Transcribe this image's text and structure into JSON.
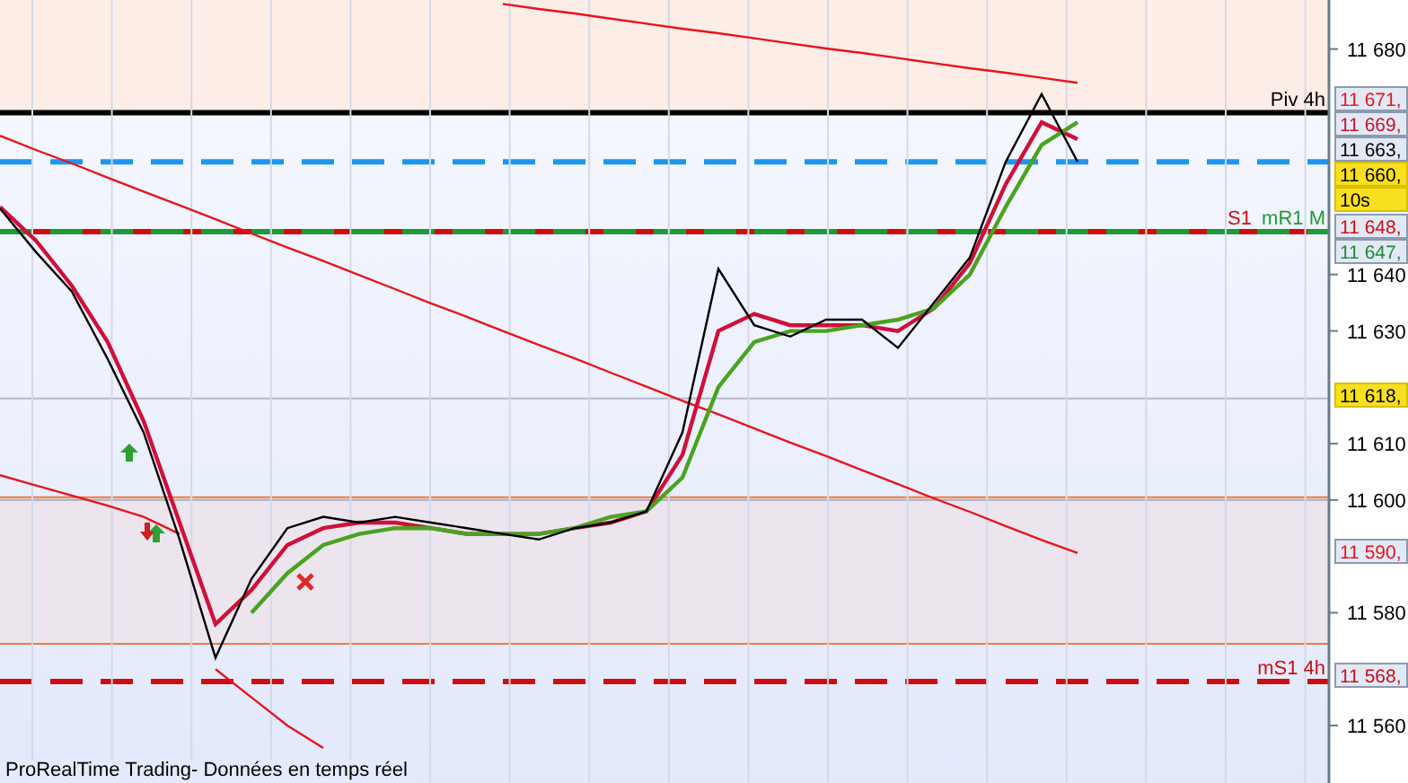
{
  "chart": {
    "chart_data": {
      "type": "line",
      "categories": [
        null,
        null,
        null,
        null,
        null,
        null,
        null,
        null,
        null,
        null,
        null,
        null,
        null,
        null,
        null,
        null,
        null,
        null,
        null,
        null,
        null,
        null,
        null,
        null,
        null,
        null,
        null,
        null,
        null,
        null,
        null
      ],
      "ylim": [
        11549.8,
        11688.7
      ],
      "grid": true,
      "bands": [
        {
          "axis": "y",
          "from": 11668.7,
          "to": 11688.7,
          "color": "#fcede7"
        },
        {
          "axis": "y",
          "from": 11574.5,
          "to": 11600.5,
          "color": "#ece5ee"
        }
      ],
      "ref_lines": [
        {
          "axis": "y",
          "value": 11618,
          "color": "#b4b8c8"
        },
        {
          "axis": "y",
          "value": 11600,
          "color": "#a8acb8"
        },
        {
          "axis": "y",
          "value": 11600.5,
          "color": "#f07a3a"
        },
        {
          "axis": "y",
          "value": 11574.5,
          "color": "#f07a3a"
        },
        {
          "axis": "y",
          "value": 11668.7,
          "color": "#000000",
          "label": "Piv 4h"
        },
        {
          "axis": "y",
          "value": 11660,
          "color": "#1e96f0"
        },
        {
          "axis": "y",
          "value": 11647.6,
          "color": "#d00c10",
          "label": "S1"
        },
        {
          "axis": "y",
          "value": 11647.6,
          "color": "#1e9a3a",
          "label": "mR1 M"
        },
        {
          "axis": "y",
          "value": 11567.8,
          "color": "#d00c10",
          "label": "mS1 4h"
        }
      ],
      "yticks": [
        {
          "value": 11560,
          "label": "11 560"
        },
        {
          "value": 11580,
          "label": "11 580"
        },
        {
          "value": 11600,
          "label": "11 600"
        },
        {
          "value": 11610,
          "label": "11 610"
        },
        {
          "value": 11630,
          "label": "11 630"
        },
        {
          "value": 11640,
          "label": "11 640"
        },
        {
          "value": 11680,
          "label": "11 680"
        }
      ],
      "series": [
        {
          "color": "#e8141c",
          "values": [
            null,
            null,
            null,
            null,
            null,
            null,
            null,
            null,
            null,
            null,
            null,
            null,
            null,
            null,
            11688.0,
            11687.1,
            11686.3,
            11685.4,
            11684.5,
            11683.6,
            11682.8,
            11681.9,
            11681.0,
            11680.1,
            11679.3,
            11678.4,
            11677.5,
            11676.6,
            11675.8,
            11674.9,
            11674.0
          ]
        },
        {
          "color": "#e8141c",
          "values": [
            11664.6,
            11662.1,
            11659.7,
            11657.2,
            11654.7,
            11652.3,
            11649.8,
            11647.3,
            11644.8,
            11642.4,
            11639.9,
            11637.4,
            11634.9,
            11632.5,
            11630.0,
            11627.5,
            11625.1,
            11622.6,
            11620.1,
            11617.6,
            11615.2,
            11612.7,
            11610.2,
            11607.8,
            11605.3,
            11602.8,
            11600.3,
            11597.9,
            11595.4,
            11592.9,
            11590.6
          ]
        },
        {
          "color": "#e8141c",
          "values": [
            11604.4,
            11602.6,
            11600.8,
            11599.0,
            11597.0,
            11594.0,
            null,
            null,
            null,
            null,
            null,
            null,
            null,
            null,
            null,
            null,
            null,
            null,
            null,
            null,
            null,
            null,
            null,
            null,
            null,
            null,
            null,
            null,
            null,
            null,
            null
          ]
        },
        {
          "color": "#e8141c",
          "values": [
            null,
            null,
            null,
            null,
            null,
            null,
            11570,
            11565,
            11560,
            11556,
            null,
            null,
            null,
            null,
            null,
            null,
            null,
            null,
            null,
            null,
            null,
            null,
            null,
            null,
            null,
            null,
            null,
            null,
            null,
            null,
            null
          ]
        },
        {
          "color": "#d0103a",
          "values": [
            11652,
            11646,
            11638,
            11628,
            11614,
            11596,
            11578,
            11584,
            11592,
            11595,
            11596,
            11596,
            11595,
            11594,
            11594,
            11594,
            11595,
            11596,
            11598,
            11608,
            11630,
            11633,
            11631,
            11631,
            11631,
            11630,
            11634,
            11642,
            11656,
            11667,
            11664
          ]
        },
        {
          "color": "#4aa320",
          "values": [
            null,
            null,
            null,
            null,
            null,
            null,
            null,
            11580,
            11587,
            11592,
            11594,
            11595,
            11595,
            11594,
            11594,
            11594,
            11595,
            11597,
            11598,
            11604,
            11620,
            11628,
            11630,
            11630,
            11631,
            11632,
            11634,
            11640,
            11652,
            11663,
            11667
          ]
        },
        {
          "color": "#000000",
          "values": [
            11651.7,
            11644,
            11637,
            11625,
            11612,
            11593,
            11572,
            11586,
            11595,
            11597,
            11596,
            11597,
            11596,
            11595,
            11594,
            11593,
            11595,
            11596,
            11598,
            11612,
            11641,
            11631,
            11629,
            11632,
            11632,
            11627,
            11635,
            11643,
            11660,
            11672,
            11660
          ]
        }
      ]
    },
    "price_tags": [
      {
        "label": "11 671,",
        "color": "#e8141c",
        "highlight": false
      },
      {
        "label": "11 669,",
        "color": "#c8102c",
        "highlight": false
      },
      {
        "label": "11 663,",
        "color": "#000000",
        "highlight": false
      },
      {
        "label": "11 660,",
        "color": "#000000",
        "highlight": true
      },
      {
        "label": "10s",
        "color": "#000000",
        "highlight": true
      },
      {
        "label": "11 648,",
        "color": "#d00c10",
        "highlight": false
      },
      {
        "label": "11 647,",
        "color": "#1e8a3a",
        "highlight": false
      },
      {
        "label": "11 618,",
        "color": "#000000",
        "highlight": true
      },
      {
        "label": "11 590,",
        "color": "#e8141c",
        "highlight": false
      },
      {
        "label": "11 568,",
        "color": "#c8101c",
        "highlight": false
      }
    ]
  },
  "footer": "ProRealTime Trading- Données en temps réel"
}
